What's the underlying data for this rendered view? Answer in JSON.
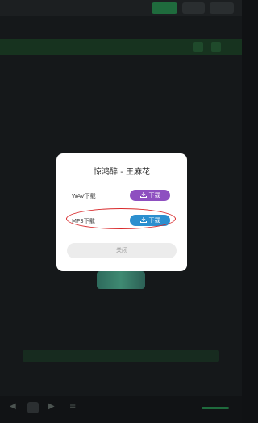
{
  "dialog": {
    "title": "惊鸿醉 - 王麻花",
    "options": [
      {
        "label": "WAV下载",
        "button": "下载",
        "color": "#8e4fc0"
      },
      {
        "label": "MP3下载",
        "button": "下载",
        "color": "#2c8fcf"
      }
    ],
    "close_label": "关闭",
    "highlight_color": "#d8292b"
  },
  "icons": {
    "download": "download-icon"
  },
  "colors": {
    "accent_green": "#1f6b3d",
    "background": "#15181a"
  }
}
